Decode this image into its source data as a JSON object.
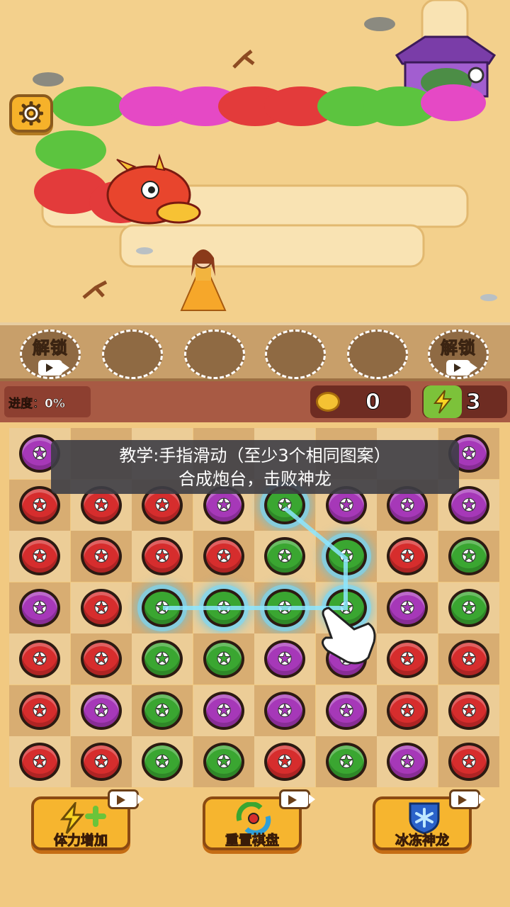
{
  "slots": [
    {
      "label": "解锁",
      "locked": true
    },
    {
      "label": "",
      "locked": false
    },
    {
      "label": "",
      "locked": false
    },
    {
      "label": "",
      "locked": false
    },
    {
      "label": "",
      "locked": false
    },
    {
      "label": "解锁",
      "locked": true
    }
  ],
  "status": {
    "progress_label": "进度：0%",
    "coins": "0",
    "energy": "3"
  },
  "tutorial": {
    "line1": "教学:手指滑动（至少3个相同图案）",
    "line2": "合成炮台，击败神龙"
  },
  "board": {
    "rows": [
      [
        "purple",
        "",
        "",
        "",
        "",
        "",
        "",
        "purple"
      ],
      [
        "red",
        "red",
        "red",
        "purple",
        "green",
        "purple",
        "purple",
        "purple"
      ],
      [
        "red",
        "red",
        "red",
        "red",
        "green",
        "green",
        "red",
        "green"
      ],
      [
        "purple",
        "red",
        "green",
        "green",
        "green",
        "green",
        "purple",
        "green"
      ],
      [
        "red",
        "red",
        "green",
        "green",
        "purple",
        "purple",
        "red",
        "red"
      ],
      [
        "red",
        "purple",
        "green",
        "purple",
        "purple",
        "purple",
        "red",
        "red"
      ],
      [
        "red",
        "red",
        "green",
        "green",
        "red",
        "green",
        "purple",
        "red"
      ]
    ],
    "selected": [
      [
        1,
        4
      ],
      [
        2,
        5
      ],
      [
        3,
        2
      ],
      [
        3,
        3
      ],
      [
        3,
        4
      ],
      [
        3,
        5
      ]
    ]
  },
  "powerups": [
    {
      "label": "体力增加",
      "icon": "lightning-plus-icon"
    },
    {
      "label": "重置棋盘",
      "icon": "shuffle-icon"
    },
    {
      "label": "冰冻神龙",
      "icon": "snowflake-shield-icon"
    }
  ],
  "colors": {
    "red": "#d62d2d",
    "green": "#3aa631",
    "purple": "#a638b8"
  }
}
